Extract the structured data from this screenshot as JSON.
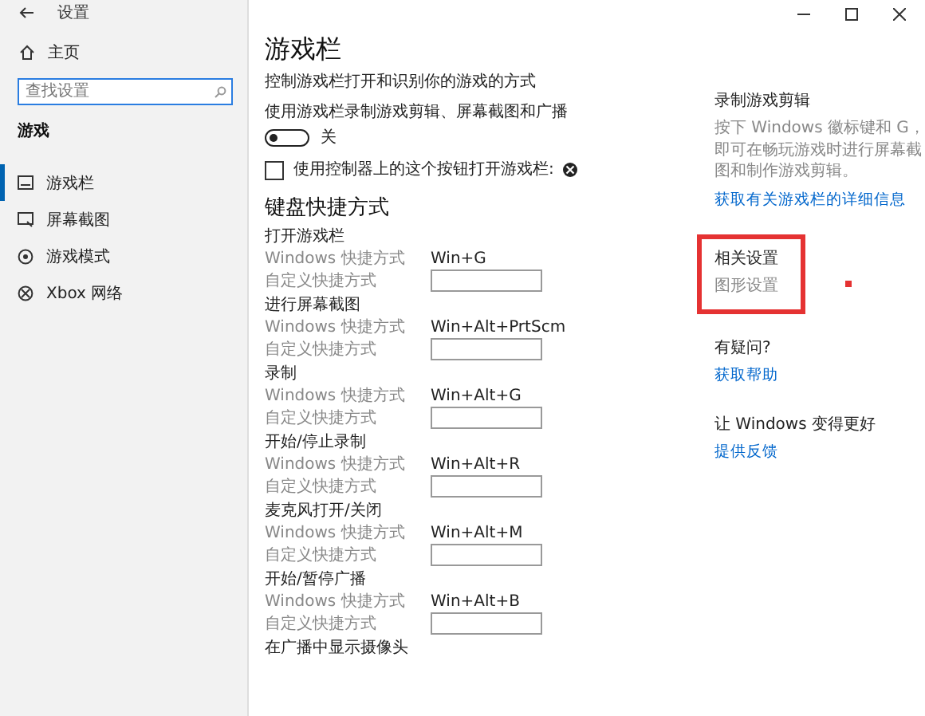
{
  "window": {
    "title": "设置"
  },
  "sidebar": {
    "home": "主页",
    "search": {
      "placeholder": "查找设置"
    },
    "section": "游戏",
    "items": [
      {
        "label": "游戏栏",
        "selected": true
      },
      {
        "label": "屏幕截图",
        "selected": false
      },
      {
        "label": "游戏模式",
        "selected": false
      },
      {
        "label": "Xbox 网络",
        "selected": false
      }
    ]
  },
  "main": {
    "title": "游戏栏",
    "description": "控制游戏栏打开和识别你的游戏的方式",
    "toggle": {
      "label": "使用游戏栏录制游戏剪辑、屏幕截图和广播",
      "on": false,
      "state_text": "关"
    },
    "checkbox": {
      "label": "使用控制器上的这个按钮打开游戏栏:",
      "checked": false
    },
    "shortcuts_heading": "键盘快捷方式",
    "shortcuts": [
      {
        "name": "打开游戏栏",
        "windows_label": "Windows 快捷方式",
        "windows_value": "Win+G",
        "custom_label": "自定义快捷方式"
      },
      {
        "name": "进行屏幕截图",
        "windows_label": "Windows 快捷方式",
        "windows_value": "Win+Alt+PrtScm",
        "custom_label": "自定义快捷方式"
      },
      {
        "name": "录制",
        "windows_label": "Windows 快捷方式",
        "windows_value": "Win+Alt+G",
        "custom_label": "自定义快捷方式"
      },
      {
        "name": "开始/停止录制",
        "windows_label": "Windows 快捷方式",
        "windows_value": "Win+Alt+R",
        "custom_label": "自定义快捷方式"
      },
      {
        "name": "麦克风打开/关闭",
        "windows_label": "Windows 快捷方式",
        "windows_value": "Win+Alt+M",
        "custom_label": "自定义快捷方式"
      },
      {
        "name": "开始/暂停广播",
        "windows_label": "Windows 快捷方式",
        "windows_value": "Win+Alt+B",
        "custom_label": "自定义快捷方式"
      },
      {
        "name": "在广播中显示摄像头"
      }
    ]
  },
  "right_panel": [
    {
      "heading": "录制游戏剪辑",
      "body": "按下 Windows 徽标键和 G，即可在畅玩游戏时进行屏幕截图和制作游戏剪辑。",
      "link": "获取有关游戏栏的详细信息"
    },
    {
      "heading": "相关设置",
      "muted_link": "图形设置",
      "highlighted": true
    },
    {
      "heading": "有疑问?",
      "link": "获取帮助"
    },
    {
      "heading": "让 Windows 变得更好",
      "link": "提供反馈"
    }
  ]
}
